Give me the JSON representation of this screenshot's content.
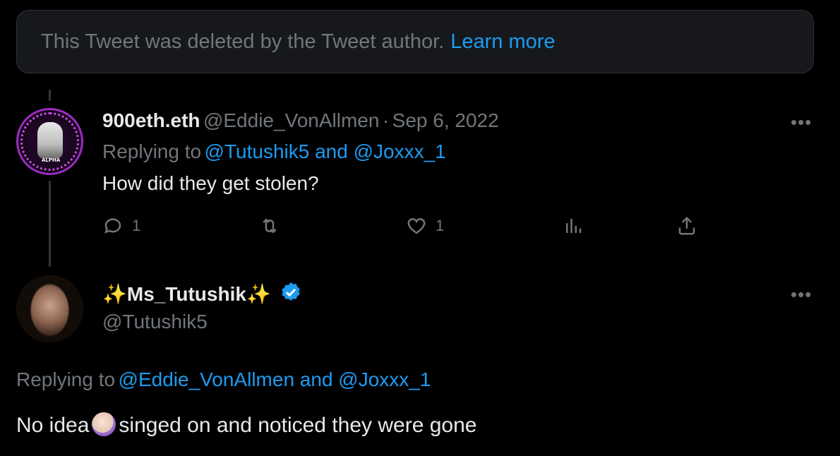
{
  "deleted_notice": {
    "text": "This Tweet was deleted by the Tweet author.",
    "link": "Learn more"
  },
  "tweet1": {
    "display_name": "900eth.eth",
    "handle": "@Eddie_VonAllmen",
    "separator": "·",
    "date": "Sep 6, 2022",
    "replying_prefix": "Replying to",
    "replying_to": "@Tutushik5 and @Joxxx_1",
    "body": "How did they get stolen?",
    "avatar_badge": "ALPHA",
    "more": "•••",
    "actions": {
      "reply_count": "1",
      "retweet_count": "",
      "like_count": "1",
      "views_count": "",
      "share_count": ""
    }
  },
  "tweet2": {
    "sparkle_left": "✨",
    "display_name": "Ms_Tutushik",
    "sparkle_right": "✨",
    "handle": "@Tutushik5",
    "verified": true,
    "replying_prefix": "Replying to",
    "replying_to": "@Eddie_VonAllmen and @Joxxx_1",
    "body_before": "No idea",
    "body_after": "singed on and noticed they were gone",
    "more": "•••"
  },
  "colors": {
    "background": "#000000",
    "text": "#e7e9ea",
    "muted": "#71767b",
    "accent": "#1d9bf0"
  },
  "icons": [
    "reply-icon",
    "retweet-icon",
    "like-icon",
    "views-icon",
    "share-icon",
    "verified-badge-icon",
    "facepalm-emoji"
  ]
}
